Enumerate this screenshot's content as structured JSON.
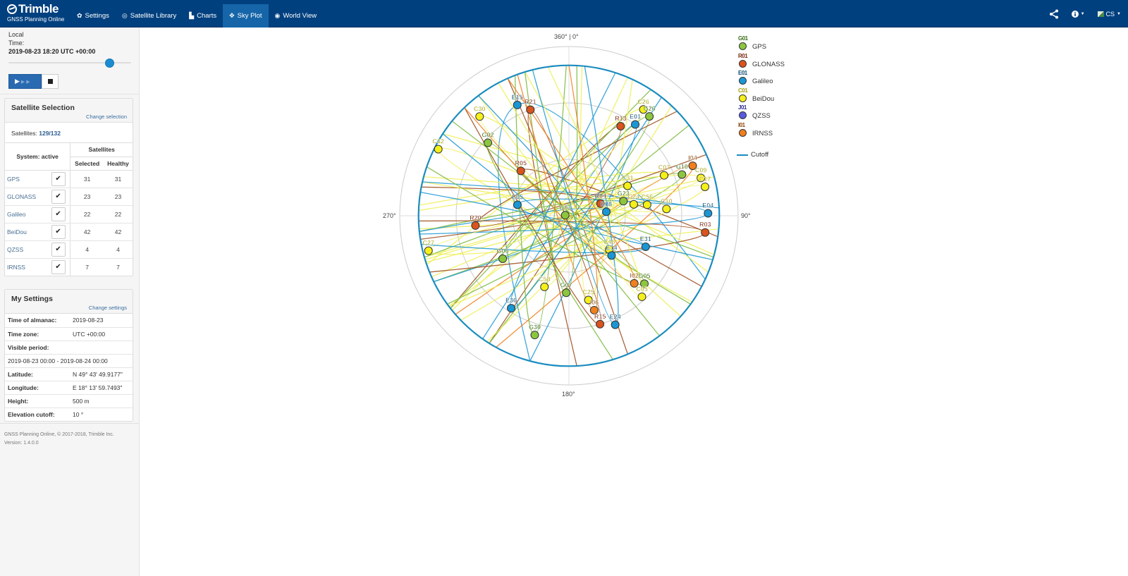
{
  "app": {
    "brand": "Trimble",
    "brand_sub": "GNSS Planning Online"
  },
  "nav": {
    "items": [
      {
        "label": "Settings",
        "icon": "gear-icon",
        "glyph": "✿",
        "active": false
      },
      {
        "label": "Satellite Library",
        "icon": "target-icon",
        "glyph": "◎",
        "active": false
      },
      {
        "label": "Charts",
        "icon": "bar-chart-icon",
        "glyph": "▙",
        "active": false
      },
      {
        "label": "Sky Plot",
        "icon": "crosshair-icon",
        "glyph": "✥",
        "active": true
      },
      {
        "label": "World View",
        "icon": "globe-icon",
        "glyph": "◉",
        "active": false
      }
    ],
    "right": {
      "share_icon": "share-icon",
      "info_icon": "info-icon",
      "language": "CS"
    }
  },
  "sidebar": {
    "time_label_1": "Local",
    "time_label_2": "Time:",
    "time_value": "2019-08-23 18:20 UTC +00:00",
    "time_slider_fraction": 0.77,
    "satellite_selection": {
      "title": "Satellite Selection",
      "change_link": "Change selection",
      "count_label": "Satellites:",
      "count_value": "129/132",
      "col_system": "System: active",
      "col_satellites": "Satellites",
      "col_selected": "Selected",
      "col_healthy": "Healthy",
      "rows": [
        {
          "system": "GPS",
          "checked": true,
          "selected": "31",
          "healthy": "31"
        },
        {
          "system": "GLONASS",
          "checked": true,
          "selected": "23",
          "healthy": "23"
        },
        {
          "system": "Galileo",
          "checked": true,
          "selected": "22",
          "healthy": "22"
        },
        {
          "system": "BeiDou",
          "checked": true,
          "selected": "42",
          "healthy": "42"
        },
        {
          "system": "QZSS",
          "checked": true,
          "selected": "4",
          "healthy": "4"
        },
        {
          "system": "IRNSS",
          "checked": true,
          "selected": "7",
          "healthy": "7"
        }
      ]
    },
    "my_settings": {
      "title": "My Settings",
      "change_link": "Change settings",
      "rows": [
        {
          "key": "Time of almanac:",
          "value": "2019-08-23"
        },
        {
          "key": "Time zone:",
          "value": "UTC +00:00"
        },
        {
          "key": "Visible period:",
          "value": ""
        },
        {
          "key": "",
          "value": "2019-08-23 00:00 - 2019-08-24 00:00",
          "full": true
        },
        {
          "key": "Latitude:",
          "value": "N 49° 43' 49.9177\""
        },
        {
          "key": "Longitude:",
          "value": "E 18° 13' 59.7493\""
        },
        {
          "key": "Height:",
          "value": "500 m"
        },
        {
          "key": "Elevation cutoff:",
          "value": "10 °"
        }
      ]
    },
    "footer_line1": "GNSS Planning Online, © 2017-2018, Trimble Inc.",
    "footer_line2": "Version: 1.4.0.0"
  },
  "skyplot": {
    "axis_labels": {
      "north": "360° | 0°",
      "east": "90°",
      "south": "180°",
      "west": "270°"
    },
    "cutoff_elevation_deg": 10,
    "colors": {
      "GPS": "#8cc63f",
      "GLONASS": "#d9541e",
      "Galileo": "#1a96d4",
      "BeiDou": "#f5f019",
      "QZSS": "#5a5ae0",
      "IRNSS": "#f07f1e",
      "cutoff": "#1a8cbf",
      "grid": "#cccccc"
    },
    "legend": [
      {
        "tag": "G01",
        "name": "GPS",
        "system": "GPS",
        "tag_color": "#3b6e1a"
      },
      {
        "tag": "R01",
        "name": "GLONASS",
        "system": "GLONASS",
        "tag_color": "#7a2a10"
      },
      {
        "tag": "E01",
        "name": "Galileo",
        "system": "Galileo",
        "tag_color": "#0d4f73"
      },
      {
        "tag": "C01",
        "name": "BeiDou",
        "system": "BeiDou",
        "tag_color": "#a6a010"
      },
      {
        "tag": "J01",
        "name": "QZSS",
        "system": "QZSS",
        "tag_color": "#2b2b8f"
      },
      {
        "tag": "I01",
        "name": "IRNSS",
        "system": "IRNSS",
        "tag_color": "#8a4a10"
      }
    ],
    "legend_cutoff": "Cutoff",
    "satellites": [
      {
        "id": "E15",
        "system": "Galileo",
        "az": 335,
        "el": 25
      },
      {
        "id": "R21",
        "system": "GLONASS",
        "az": 340,
        "el": 30
      },
      {
        "id": "C30",
        "system": "BeiDou",
        "az": 318,
        "el": 19
      },
      {
        "id": "G02",
        "system": "GPS",
        "az": 312,
        "el": 32
      },
      {
        "id": "C32",
        "system": "BeiDou",
        "az": 297,
        "el": 12
      },
      {
        "id": "R05",
        "system": "GLONASS",
        "az": 313,
        "el": 55
      },
      {
        "id": "R13",
        "system": "GLONASS",
        "az": 30,
        "el": 35
      },
      {
        "id": "E01",
        "system": "Galileo",
        "az": 36,
        "el": 30
      },
      {
        "id": "C26",
        "system": "BeiDou",
        "az": 35,
        "el": 21
      },
      {
        "id": "G26",
        "system": "GPS",
        "az": 39,
        "el": 22
      },
      {
        "id": "C31",
        "system": "BeiDou",
        "az": 63,
        "el": 55
      },
      {
        "id": "C07",
        "system": "BeiDou",
        "az": 67,
        "el": 35
      },
      {
        "id": "G10",
        "system": "GPS",
        "az": 70,
        "el": 26
      },
      {
        "id": "I04",
        "system": "IRNSS",
        "az": 68,
        "el": 19
      },
      {
        "id": "C09",
        "system": "BeiDou",
        "az": 74,
        "el": 17
      },
      {
        "id": "C17",
        "system": "BeiDou",
        "az": 78,
        "el": 16
      },
      {
        "id": "R04",
        "system": "GLONASS",
        "az": 69,
        "el": 72
      },
      {
        "id": "G23",
        "system": "GPS",
        "az": 75,
        "el": 60
      },
      {
        "id": "C24",
        "system": "BeiDou",
        "az": 80,
        "el": 55
      },
      {
        "id": "C56",
        "system": "BeiDou",
        "az": 82,
        "el": 48
      },
      {
        "id": "E08",
        "system": "Galileo",
        "az": 84,
        "el": 70
      },
      {
        "id": "C10",
        "system": "BeiDou",
        "az": 86,
        "el": 38
      },
      {
        "id": "E04",
        "system": "Galileo",
        "az": 89,
        "el": 16
      },
      {
        "id": "R03",
        "system": "GLONASS",
        "az": 97,
        "el": 17
      },
      {
        "id": "G03",
        "system": "GPS",
        "az": 278,
        "el": 88
      },
      {
        "id": "E05",
        "system": "Galileo",
        "az": 282,
        "el": 62
      },
      {
        "id": "R20",
        "system": "GLONASS",
        "az": 264,
        "el": 40
      },
      {
        "id": "C27",
        "system": "BeiDou",
        "az": 256,
        "el": 13
      },
      {
        "id": "G06",
        "system": "GPS",
        "az": 237,
        "el": 48
      },
      {
        "id": "C46",
        "system": "BeiDou",
        "az": 130,
        "el": 62
      },
      {
        "id": "E14",
        "system": "Galileo",
        "az": 133,
        "el": 59
      },
      {
        "id": "E31",
        "system": "Galileo",
        "az": 112,
        "el": 46
      },
      {
        "id": "C58",
        "system": "BeiDou",
        "az": 199,
        "el": 50
      },
      {
        "id": "G07",
        "system": "GPS",
        "az": 182,
        "el": 49
      },
      {
        "id": "C25",
        "system": "BeiDou",
        "az": 167,
        "el": 44
      },
      {
        "id": "I06",
        "system": "IRNSS",
        "az": 165,
        "el": 38
      },
      {
        "id": "R15",
        "system": "GLONASS",
        "az": 164,
        "el": 30
      },
      {
        "id": "E24",
        "system": "Galileo",
        "az": 157,
        "el": 27
      },
      {
        "id": "E36",
        "system": "Galileo",
        "az": 212,
        "el": 32
      },
      {
        "id": "G30",
        "system": "GPS",
        "az": 196,
        "el": 24
      },
      {
        "id": "I02",
        "system": "IRNSS",
        "az": 136,
        "el": 40
      },
      {
        "id": "G05",
        "system": "GPS",
        "az": 132,
        "el": 36
      },
      {
        "id": "C05",
        "system": "BeiDou",
        "az": 138,
        "el": 32
      }
    ]
  }
}
